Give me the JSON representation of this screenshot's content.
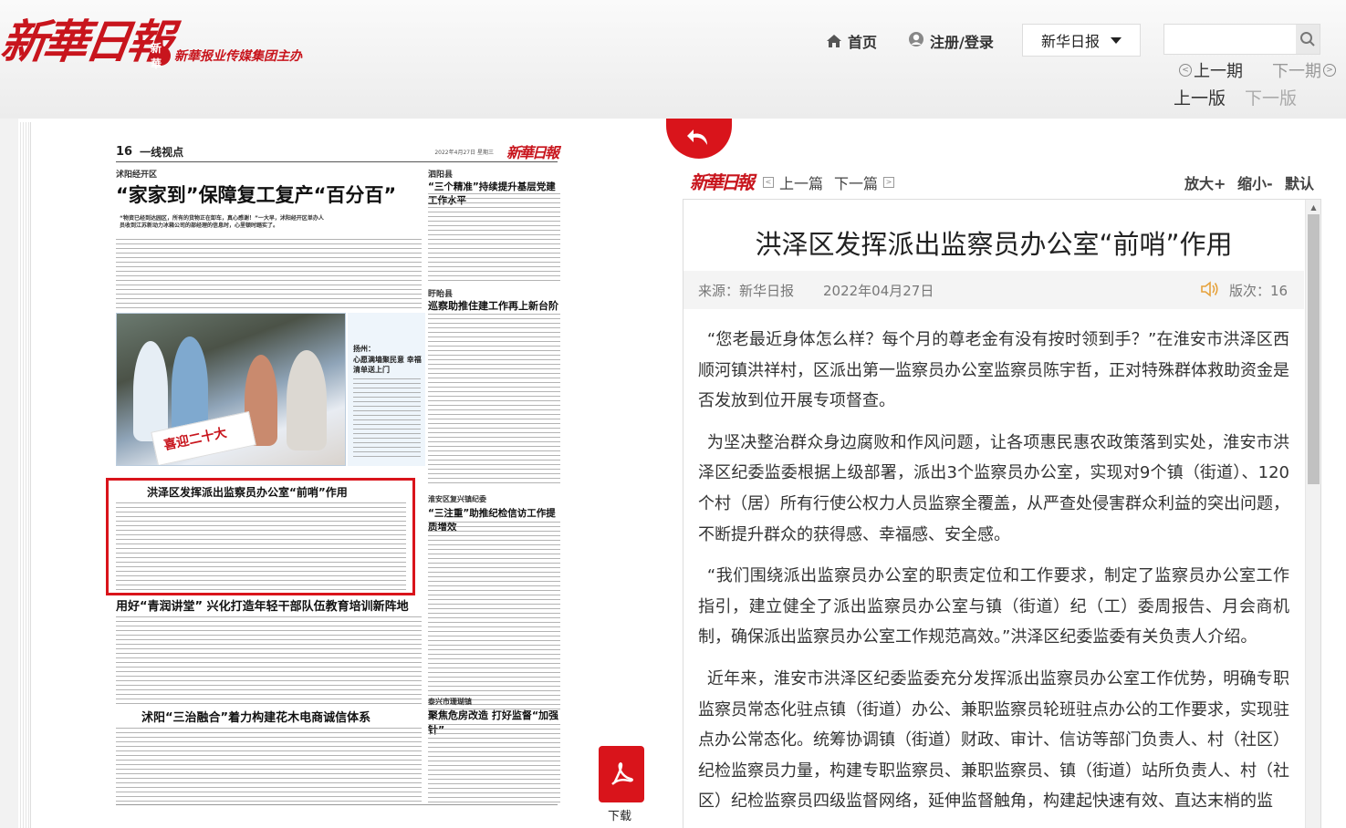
{
  "header": {
    "logo_text": "新華日報",
    "sub_logo_emblem": "新華",
    "sub_logo_text": "新華报业传媒集团主办",
    "nav": {
      "home_label": "首页",
      "login_label": "注册/登录"
    },
    "paper_select": {
      "selected": "新华日报"
    },
    "search": {
      "value": "",
      "placeholder": ""
    },
    "issue_prev": "上一期",
    "issue_next": "下一期",
    "page_prev": "上一版",
    "page_next": "下一版"
  },
  "newspaper": {
    "page_number": "16",
    "section": "一线视点",
    "date_text": "2022年4月27日 星期三",
    "logo": "新華日報",
    "kicker1": "沭阳经开区",
    "headline1": "“家家到”保障复工复产“百分百”",
    "lead1": "“物资已经到达园区，所有的货物正在卸车，真心感谢！”一大早，沭阳经开区单办人员收到江苏新动力冰箱公司的部经理的信息时，心里顿时踏实了。",
    "kicker2": "泗阳县",
    "headline2": "“三个精准”持续提升基层党建工作水平",
    "kicker3": "盱眙县",
    "headline3": "巡察助推住建工作再上新台阶",
    "photo_sign": "喜迎二十大",
    "caption_kicker": "扬州：",
    "caption_title": "心愿满墙聚民意 幸福清单送上门",
    "headline_boxed": "洪泽区发挥派出监察员办公室“前哨”作用",
    "kicker4": "淮安区复兴镇纪委",
    "headline4": "“三注重”助推纪检信访工作提质增效",
    "headline5": "用好“青润讲堂” 兴化打造年轻干部队伍教育培训新阵地",
    "headline6": "沭阳“三治融合”着力构建花木电商诚信体系",
    "kicker5": "泰兴市珊瑚镇",
    "headline7": "聚焦危房改造 打好监督“加强针”",
    "download_label": "下载"
  },
  "article": {
    "logo": "新華日報",
    "prev_label": "上一篇",
    "next_label": "下一篇",
    "zoom_in": "放大+",
    "zoom_out": "缩小-",
    "zoom_default": "默认",
    "title": "洪泽区发挥派出监察员办公室“前哨”作用",
    "source": "来源：新华日报",
    "date": "2022年04月27日",
    "page_label": "版次：16",
    "paragraphs": [
      "“您老最近身体怎么样？每个月的尊老金有没有按时领到手？”在淮安市洪泽区西顺河镇洪祥村，区派出第一监察员办公室监察员陈宇哲，正对特殊群体救助资金是否发放到位开展专项督查。",
      "为坚决整治群众身边腐败和作风问题，让各项惠民惠农政策落到实处，淮安市洪泽区纪委监委根据上级部署，派出3个监察员办公室，实现对9个镇（街道）、120个村（居）所有行使公权力人员监察全覆盖，从严查处侵害群众利益的突出问题，不断提升群众的获得感、幸福感、安全感。",
      "“我们围绕派出监察员办公室的职责定位和工作要求，制定了监察员办公室工作指引，建立健全了派出监察员办公室与镇（街道）纪（工）委周报告、月会商机制，确保派出监察员办公室工作规范高效。”洪泽区纪委监委有关负责人介绍。",
      "近年来，淮安市洪泽区纪委监委充分发挥派出监察员办公室工作优势，明确专职监察员常态化驻点镇（街道）办公、兼职监察员轮班驻点办公的工作要求，实现驻点办公常态化。统筹协调镇（街道）财政、审计、信访等部门负责人、村（社区）纪检监察员力量，构建专职监察员、兼职监察员、镇（街道）站所负责人、村（社区）纪检监察员四级监督网络，延伸监督触角，构建起快速有效、直达末梢的监"
    ]
  },
  "colors": {
    "brand_red": "#d9141b",
    "text": "#333333",
    "muted": "#777777"
  },
  "icons": [
    "home-icon",
    "user-icon",
    "chevron-down-icon",
    "search-icon",
    "arrow-left-circle-icon",
    "arrow-right-circle-icon",
    "back-arrow-icon",
    "pdf-icon",
    "speaker-icon"
  ]
}
